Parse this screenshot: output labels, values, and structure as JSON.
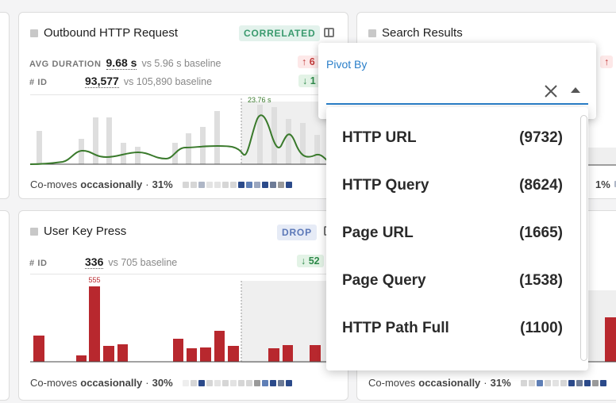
{
  "cards": {
    "outbound": {
      "title": "Outbound HTTP Request",
      "badge": "CORRELATED",
      "metrics": [
        {
          "label": "AVG DURATION",
          "value": "9.68 s",
          "baseline": "vs 5.96 s baseline",
          "delta_arrow": "↑",
          "delta": "6"
        },
        {
          "label": "# ID",
          "value": "93,577",
          "baseline": "vs 105,890 baseline",
          "delta_arrow": "↓",
          "delta": "1"
        }
      ],
      "peak_label": "23.76 s",
      "comoves_prefix": "Co-moves",
      "comoves_word": "occasionally",
      "comoves_sep": "·",
      "comoves_pct": "31%"
    },
    "search": {
      "title": "Search Results",
      "delta_arrow": "↑",
      "comoves_pct": "1%"
    },
    "keypress": {
      "title": "User Key Press",
      "badge": "DROP",
      "metric": {
        "label": "# ID",
        "value": "336",
        "baseline": "vs 705 baseline",
        "delta_arrow": "↓",
        "delta": "52"
      },
      "peak_label": "555",
      "comoves_prefix": "Co-moves",
      "comoves_word": "occasionally",
      "comoves_sep": "·",
      "comoves_pct": "30%"
    },
    "bottom_right": {
      "comoves_prefix": "Co-moves",
      "comoves_word": "occasionally",
      "comoves_sep": "·",
      "comoves_pct": "31%"
    }
  },
  "pivot": {
    "label": "Pivot By",
    "value": "",
    "options": [
      {
        "name": "HTTP URL",
        "count": "(9732)"
      },
      {
        "name": "HTTP Query",
        "count": "(8624)"
      },
      {
        "name": "Page URL",
        "count": "(1665)"
      },
      {
        "name": "Page Query",
        "count": "(1538)"
      },
      {
        "name": "HTTP Path Full",
        "count": "(1100)"
      }
    ]
  },
  "colors": {
    "accent": "#2a7fc9",
    "line_green": "#3a7a2c",
    "bar_red": "#b8282e",
    "bar_gray": "#dedede"
  },
  "icons": [
    "columns-icon",
    "close-icon",
    "caret-up-icon"
  ]
}
